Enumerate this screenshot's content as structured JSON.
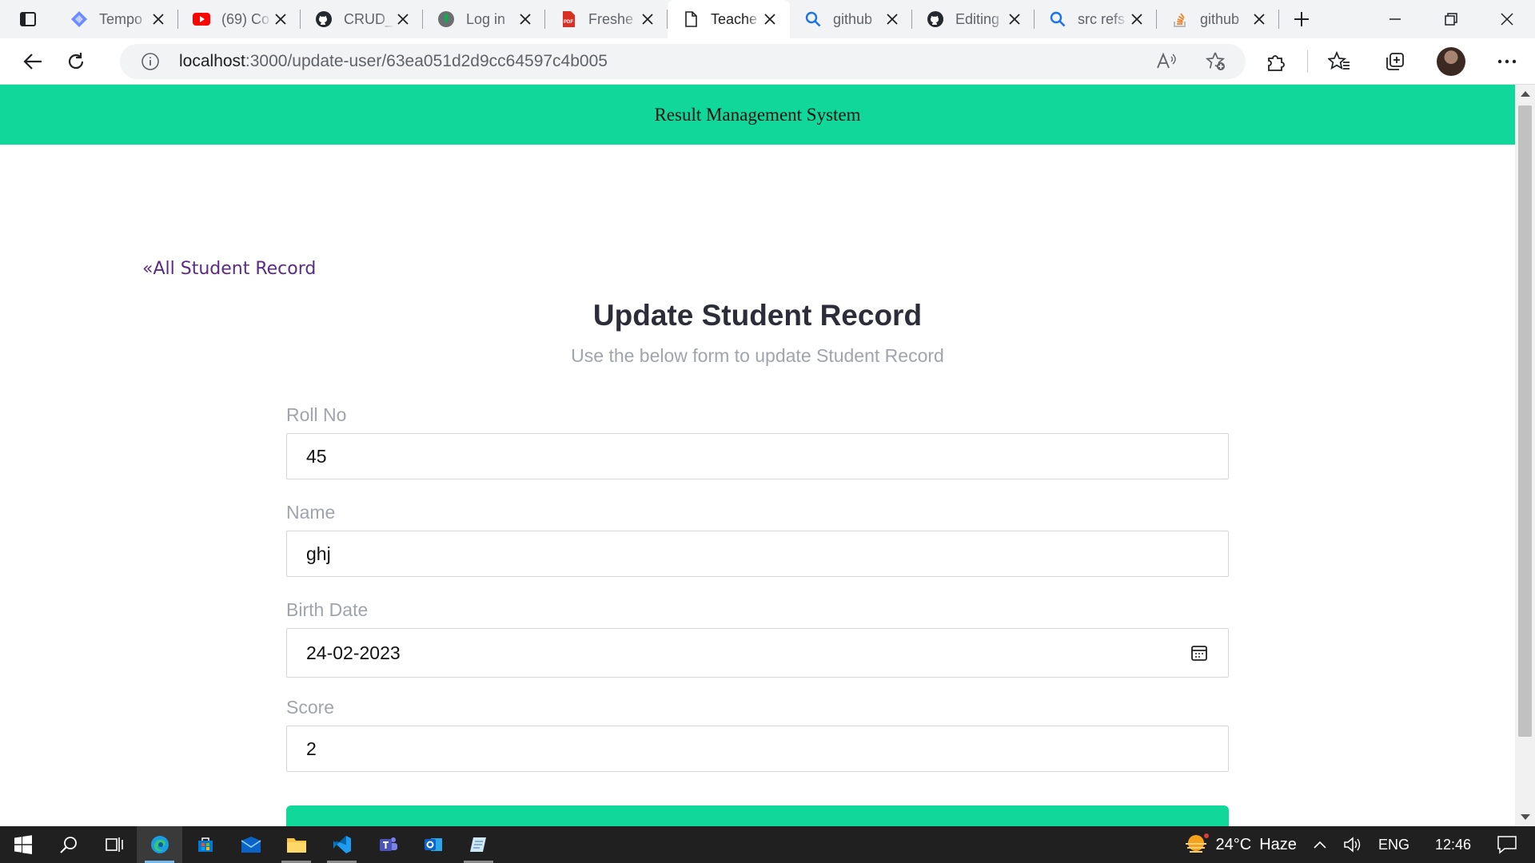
{
  "browser": {
    "tabs": [
      {
        "title": "Tempo",
        "icon": "tempo-icon",
        "icon_color": "#6b8cff"
      },
      {
        "title": "(69) Co",
        "icon": "youtube-icon",
        "icon_color": "#ff0000"
      },
      {
        "title": "CRUD_",
        "icon": "github-icon",
        "icon_color": "#24292f"
      },
      {
        "title": "Log in",
        "icon": "mongodb-leaf-icon",
        "icon_color": "#13aa52"
      },
      {
        "title": "Freshe",
        "icon": "pdf-icon",
        "icon_color": "#d93025"
      },
      {
        "title": "Teache",
        "icon": "document-icon",
        "icon_color": "#5f6368",
        "active": true
      },
      {
        "title": "github",
        "icon": "search-icon",
        "icon_color": "#1a73e8"
      },
      {
        "title": "Editing",
        "icon": "github-icon",
        "icon_color": "#24292f"
      },
      {
        "title": "src refs",
        "icon": "search-icon",
        "icon_color": "#1a73e8"
      },
      {
        "title": "github",
        "icon": "stackoverflow-icon",
        "icon_color": "#f48024"
      }
    ],
    "url_host": "localhost",
    "url_path": ":3000/update-user/63ea051d2d9cc64597c4b005"
  },
  "app": {
    "header_title": "Result Management System",
    "back_link_arrows": "«",
    "back_link_text": "All Student Record",
    "page_title": "Update Student Record",
    "page_subtitle": "Use the below form to update Student Record",
    "fields": {
      "roll_label": "Roll No",
      "roll_value": "45",
      "name_label": "Name",
      "name_value": "ghj",
      "birth_label": "Birth Date",
      "birth_value": "24-02-2023",
      "score_label": "Score",
      "score_value": "2"
    },
    "accent_color": "#0fd89a"
  },
  "taskbar": {
    "weather_temp": "24°C",
    "weather_desc": "Haze",
    "language": "ENG",
    "time": "12:46"
  }
}
